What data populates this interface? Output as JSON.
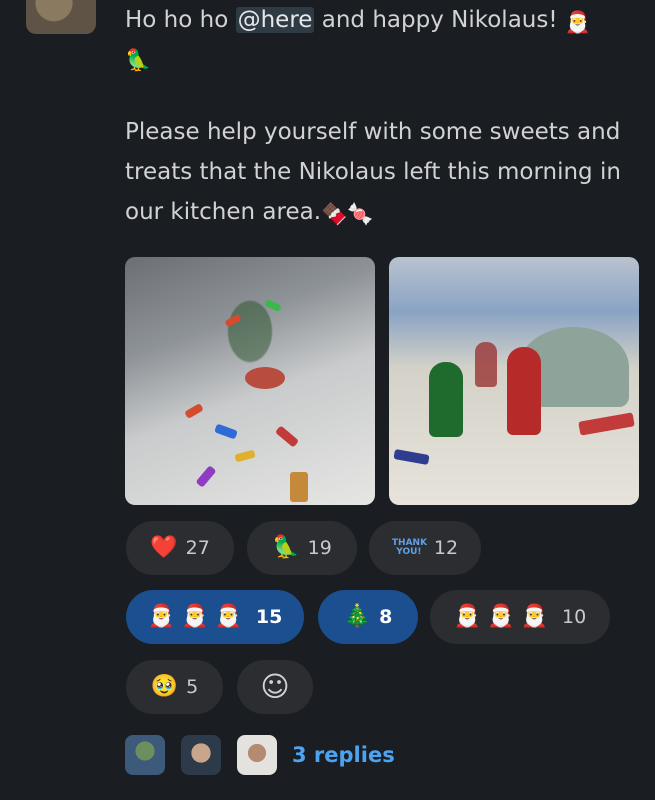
{
  "message": {
    "greeting_prefix": "Ho ho ho ",
    "mention": "@here",
    "greeting_suffix": " and happy Nikolaus!",
    "emoji_santa": "🎅",
    "emoji_parrot": "🦜",
    "body": "Please help yourself with some sweets and treats that the Nikolaus left this morning in our kitchen area.",
    "emoji_chocolate": "🍫",
    "emoji_candy": "🍬"
  },
  "reactions": [
    {
      "icon": "❤️",
      "icon_name": "heart-icon",
      "count": "27",
      "active": false
    },
    {
      "icon": "🦜",
      "icon_name": "santa-parrot-icon",
      "count": "19",
      "active": false
    },
    {
      "icon": "THANK YOU!",
      "icon_name": "thank-you-icon",
      "count": "12",
      "active": false
    },
    {
      "icon": "🎅🎅🎅",
      "icon_name": "santa-icon",
      "count": "15",
      "active": true
    },
    {
      "icon": "🎄",
      "icon_name": "christmas-tree-icon",
      "count": "8",
      "active": true
    },
    {
      "icon": "🎅🎅🎅",
      "icon_name": "santa-skin-tones-icon",
      "count": "10",
      "active": false
    },
    {
      "icon": "🥹",
      "icon_name": "holding-back-tears-icon",
      "count": "5",
      "active": false
    }
  ],
  "add_reaction_icon": "☺",
  "thread": {
    "replies_label": "3 replies"
  },
  "colors": {
    "background": "#1a1d21",
    "pill": "#2b2d31",
    "pill_active": "#1b4f8f",
    "link": "#4ea3f1"
  }
}
